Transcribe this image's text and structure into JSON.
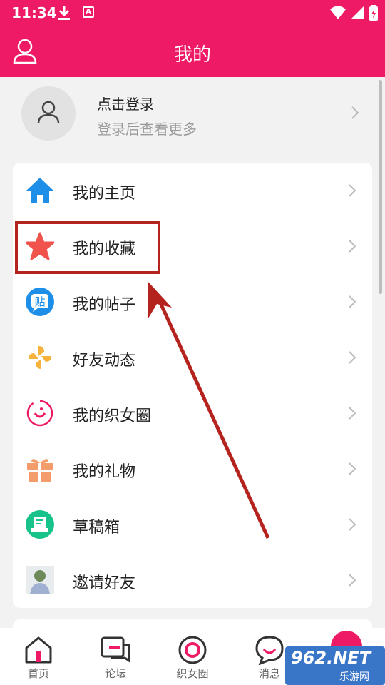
{
  "status_bar": {
    "time": "11:34"
  },
  "header": {
    "title": "我的"
  },
  "login": {
    "title": "点击登录",
    "subtitle": "登录后查看更多"
  },
  "menu": [
    {
      "label": "我的主页",
      "icon": "home-icon"
    },
    {
      "label": "我的收藏",
      "icon": "star-icon"
    },
    {
      "label": "我的帖子",
      "icon": "post-icon"
    },
    {
      "label": "好友动态",
      "icon": "pinwheel-icon"
    },
    {
      "label": "我的织女圈",
      "icon": "circle-icon"
    },
    {
      "label": "我的礼物",
      "icon": "gift-icon"
    },
    {
      "label": "草稿箱",
      "icon": "draft-icon"
    },
    {
      "label": "邀请好友",
      "icon": "invite-avatar"
    }
  ],
  "tabs": [
    {
      "label": "首页",
      "icon": "home-tab-icon"
    },
    {
      "label": "论坛",
      "icon": "forum-tab-icon"
    },
    {
      "label": "织女圈",
      "icon": "circle-tab-icon"
    },
    {
      "label": "消息",
      "icon": "message-tab-icon"
    }
  ],
  "post_icon_glyph": "贴",
  "watermark": {
    "brand": "962.NET",
    "site": "乐游网"
  },
  "colors": {
    "brand": "#ee1a66",
    "highlight": "#b5231f"
  }
}
